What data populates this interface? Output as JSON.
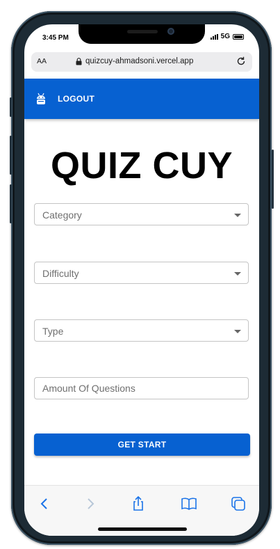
{
  "status_bar": {
    "time": "3:45 PM",
    "network": "5G"
  },
  "browser": {
    "text_size_label": "AA",
    "address": "quizcuy-ahmadsoni.vercel.app",
    "icons": [
      "lock-icon",
      "reload-icon"
    ]
  },
  "app_bar": {
    "icon": "robot-icon",
    "logout_label": "LOGOUT"
  },
  "main": {
    "title": "QUIZ CUY",
    "fields": {
      "category": {
        "label": "Category"
      },
      "difficulty": {
        "label": "Difficulty"
      },
      "type": {
        "label": "Type"
      },
      "amount": {
        "placeholder": "Amount Of Questions",
        "value": ""
      }
    },
    "start_label": "GET START"
  },
  "safari_toolbar": {
    "icons": [
      "back-icon",
      "forward-icon",
      "share-icon",
      "bookmarks-icon",
      "tabs-icon"
    ]
  },
  "colors": {
    "primary": "#0761d1",
    "frame": "#1d2b35"
  }
}
